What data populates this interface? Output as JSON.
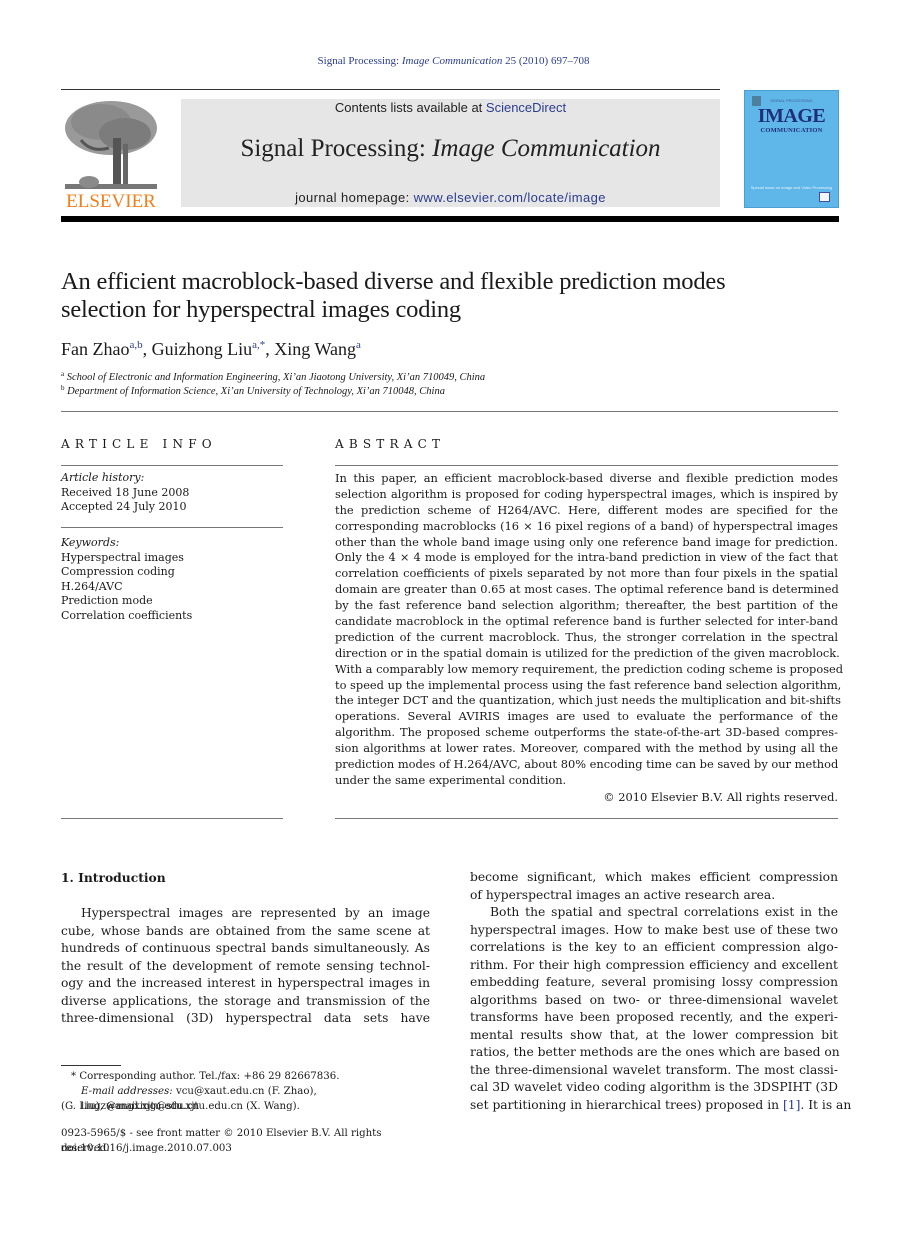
{
  "header": {
    "journal_ref_prefix": "Signal Processing: ",
    "journal_ref_italic": "Image Communication",
    "journal_ref_suffix": " 25 (2010) 697–708",
    "contents_prefix": "Contents lists available at ",
    "contents_link": "ScienceDirect",
    "journal_title_plain": "Signal Processing: ",
    "journal_title_italic": "Image Communication",
    "homepage_prefix": "journal homepage: ",
    "homepage_link": "www.elsevier.com/locate/image",
    "publisher_logo_text": "ELSEVIER",
    "cover": {
      "top_text": "SIGNAL PROCESSING",
      "title": "IMAGE",
      "subtitle": "COMMUNICATION",
      "footer_text": "Special Issue on Image and Video Processing"
    },
    "colors": {
      "link": "#2b3d8f",
      "elsevier_orange": "#f07f1a",
      "cover_blue": "#5fb6e8",
      "masthead_gray": "#e6e6e6"
    }
  },
  "article": {
    "title_lines": [
      "An efficient macroblock-based diverse and flexible prediction modes",
      "selection for hyperspectral images coding"
    ],
    "authors": [
      {
        "name": "Fan Zhao",
        "sup": "a,b",
        "sep": ", "
      },
      {
        "name": "Guizhong Liu",
        "sup": "a,*",
        "sep": ", "
      },
      {
        "name": "Xing Wang",
        "sup": "a",
        "sep": ""
      }
    ],
    "affiliations": [
      {
        "mark": "a",
        "text": "School of Electronic and Information Engineering, Xi’an Jiaotong University, Xi’an 710049, China"
      },
      {
        "mark": "b",
        "text": "Department of Information Science, Xi’an University of Technology, Xi’an 710048, China"
      }
    ]
  },
  "article_info": {
    "heading": "ARTICLE INFO",
    "history_label": "Article history:",
    "received": "Received 18 June 2008",
    "accepted": "Accepted 24 July 2010",
    "keywords_label": "Keywords:",
    "keywords": [
      "Hyperspectral images",
      "Compression coding",
      "H.264/AVC",
      "Prediction mode",
      "Correlation coefficients"
    ]
  },
  "abstract": {
    "heading": "ABSTRACT",
    "lines": [
      "In this paper, an efficient macroblock-based diverse and flexible prediction modes",
      "selection algorithm is proposed for coding hyperspectral images, which is inspired by",
      "the prediction scheme of H264/AVC. Here, different modes are specified for the",
      "corresponding macroblocks (16 × 16 pixel regions of a band) of hyperspectral images",
      "other than the whole band image using only one reference band image for prediction.",
      "Only the 4 × 4 mode is employed for the intra-band prediction in view of the fact that",
      "correlation coefficients of pixels separated by not more than four pixels in the spatial",
      "domain are greater than 0.65 at most cases. The optimal reference band is determined",
      "by the fast reference band selection algorithm; thereafter, the best partition of the",
      "candidate macroblock in the optimal reference band is further selected for inter-band",
      "prediction of the current macroblock. Thus, the stronger correlation in the spectral",
      "direction or in the spatial domain is utilized for the prediction of the given macroblock.",
      "With a comparably low memory requirement, the prediction coding scheme is proposed",
      "to speed up the implemental process using the fast reference band selection algorithm,",
      "the integer DCT and the quantization, which just needs the multiplication and bit-shifts",
      "operations. Several AVIRIS images are used to evaluate the performance of the",
      "algorithm. The proposed scheme outperforms the state-of-the-art 3D-based compres-",
      "sion algorithms at lower rates. Moreover, compared with the method by using all the",
      "prediction modes of H.264/AVC, about 80% encoding time can be saved by our method",
      "under the same experimental condition."
    ],
    "copyright": "© 2010 Elsevier B.V. All rights reserved."
  },
  "introduction": {
    "heading": "1.  Introduction",
    "left_lines": [
      "Hyperspectral images are represented by an image",
      "cube, whose bands are obtained from the same scene at",
      "hundreds of continuous spectral bands simultaneously. As",
      "the result of the development of remote sensing technol-",
      "ogy and the increased interest in hyperspectral images in",
      "diverse applications, the storage and transmission of the",
      "three-dimensional (3D) hyperspectral data sets have"
    ],
    "right_lines": [
      "become significant, which makes efficient compression",
      "of hyperspectral images an active research area.",
      "Both the spatial and spectral correlations exist in the",
      "hyperspectral images. How to make best use of these two",
      "correlations is the key to an efficient compression algo-",
      "rithm. For their high compression efficiency and excellent",
      "embedding feature, several promising lossy compression",
      "algorithms based on two- or three-dimensional wavelet",
      "transforms have been proposed recently, and the experi-",
      "mental results show that, at the lower compression bit",
      "ratios, the better methods are the ones which are based on",
      "the three-dimensional wavelet transform. The most classi-",
      "cal 3D wavelet video coding algorithm is the 3DSPIHT (3D"
    ],
    "right_last_prefix": "set partitioning in hierarchical trees) proposed in ",
    "right_last_ref": "[1]",
    "right_last_suffix": ". It is an"
  },
  "footnotes": {
    "corresponding": "* Corresponding author. Tel./fax: +86 29 82667836.",
    "email_label": "E-mail addresses:",
    "email_line1": " vcu@xaut.edu.cn (F. Zhao), liugz@mail.xjtu.edu.cn",
    "email_line2": "(G. Liu), wangxing@stu.xjtu.edu.cn (X. Wang).",
    "front_matter": "0923-5965/$ - see front matter © 2010 Elsevier B.V. All rights reserved.",
    "doi": "doi:10.1016/j.image.2010.07.003"
  }
}
